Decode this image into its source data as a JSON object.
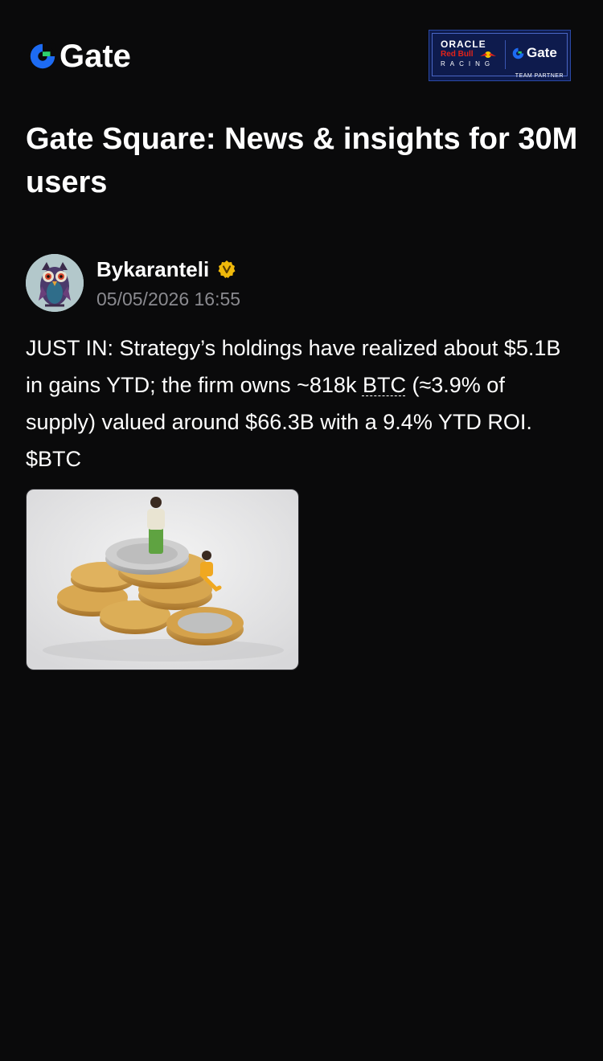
{
  "header": {
    "logo_text": "Gate",
    "partner_badge": {
      "oracle": "ORACLE",
      "red_bull": "Red Bull",
      "racing": "RACING",
      "gate": "Gate",
      "team_partner": "TEAM PARTNER"
    }
  },
  "page": {
    "title": "Gate Square: News & insights for 30M users"
  },
  "post": {
    "author": {
      "name": "Bykaranteli",
      "verified_icon": "verified-badge-icon",
      "avatar_icon": "owl-avatar"
    },
    "timestamp": "05/05/2026 16:55",
    "body": {
      "part1": "JUST IN: Strategy’s holdings have realized about $5.1B in gains YTD; the firm owns ~818k ",
      "ticker1": "BTC",
      "part2": " (≈3.9% of supply) valued around $66.3B with a 9.4% YTD ROI. $BTC"
    },
    "image": {
      "subject": "figurines-on-coin-stack"
    }
  },
  "colors": {
    "background": "#0a0a0b",
    "brand_blue": "#1d6bf3",
    "brand_green": "#2dd06e",
    "muted_text": "#8a8a8f",
    "verified_gold": "#f0b90b"
  }
}
